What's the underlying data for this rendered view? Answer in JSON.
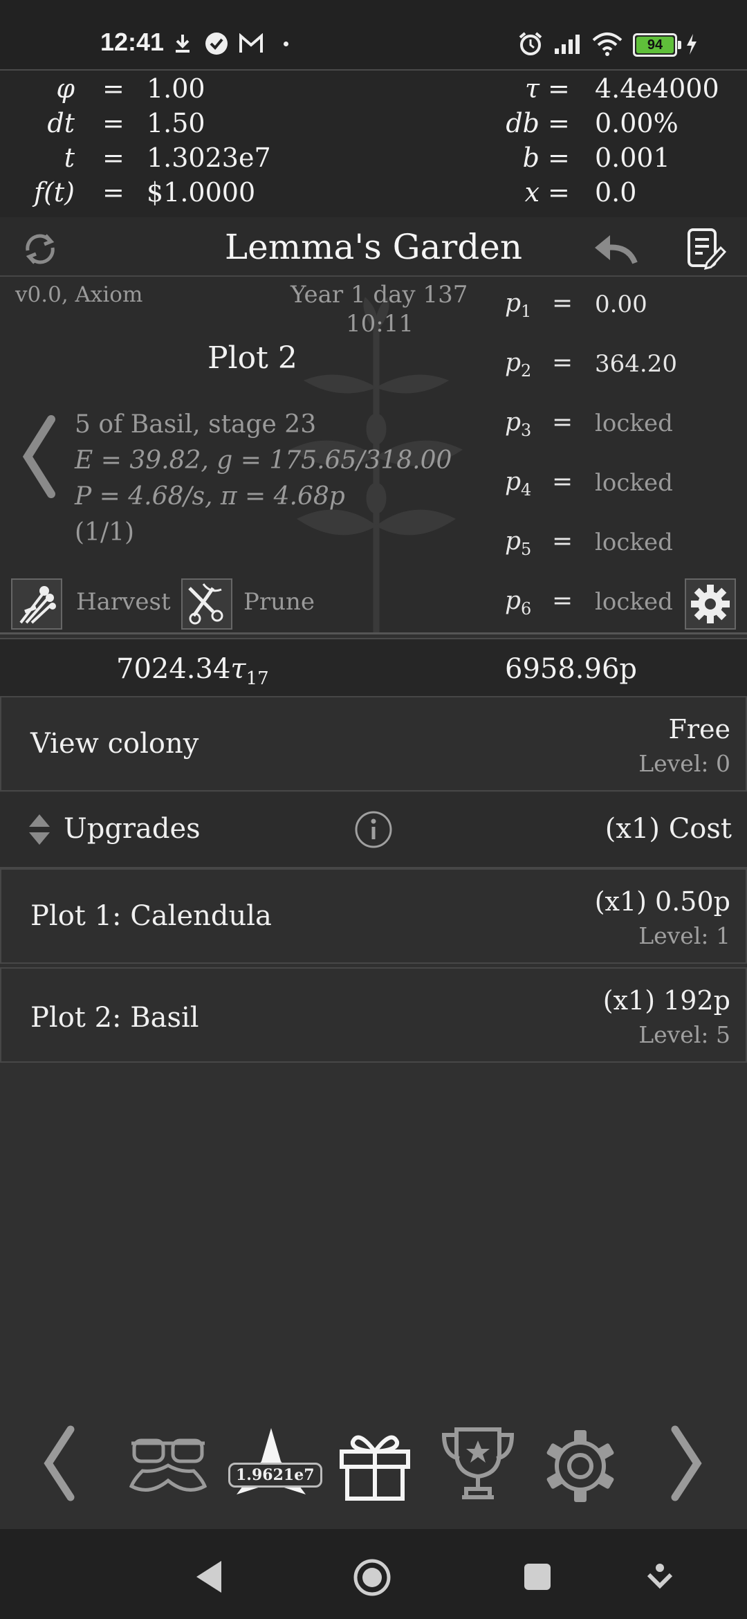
{
  "status_bar": {
    "time": "12:41",
    "battery_level": "94",
    "icons": [
      "download-icon",
      "check-circle-icon",
      "gmail-icon",
      "dot-icon",
      "alarm-icon",
      "signal-icon",
      "wifi-icon",
      "battery-icon",
      "charging-icon"
    ]
  },
  "equations": {
    "left": [
      {
        "lhs": "φ",
        "op": "=",
        "rhs": "1.00"
      },
      {
        "lhs": "dt",
        "op": "=",
        "rhs": "1.50"
      },
      {
        "lhs": "t",
        "op": "=",
        "rhs": "1.3023e7"
      },
      {
        "lhs": "f(t)",
        "op": "=",
        "rhs": "$1.0000"
      }
    ],
    "right": [
      {
        "lhs": "τ",
        "op": "=",
        "rhs": "4.4e4000"
      },
      {
        "lhs": "db",
        "op": "=",
        "rhs": "0.00%"
      },
      {
        "lhs": "b",
        "op": "=",
        "rhs": "0.001"
      },
      {
        "lhs": "x",
        "op": "=",
        "rhs": "0.0"
      }
    ]
  },
  "header": {
    "title": "Lemma's Garden",
    "icons": [
      "refresh-icon",
      "undo-icon",
      "notes-edit-icon"
    ]
  },
  "garden": {
    "version": "v0.0, Axiom",
    "date": "Year 1 day 137",
    "clock": "10:11",
    "plot_title": "Plot 2",
    "plant_lines": [
      "5 of Basil,  stage 23",
      "E = 39.82,  g = 175.65/318.00",
      "P = 4.68/s,  π = 4.68p",
      "(1/1)"
    ],
    "harvest_label": "Harvest",
    "prune_label": "Prune",
    "params": [
      {
        "name": "p",
        "sub": "1",
        "op": "=",
        "value": "0.00"
      },
      {
        "name": "p",
        "sub": "2",
        "op": "=",
        "value": "364.20"
      },
      {
        "name": "p",
        "sub": "3",
        "op": "=",
        "value": "locked"
      },
      {
        "name": "p",
        "sub": "4",
        "op": "=",
        "value": "locked"
      },
      {
        "name": "p",
        "sub": "5",
        "op": "=",
        "value": "locked"
      },
      {
        "name": "p",
        "sub": "6",
        "op": "=",
        "value": "locked"
      }
    ]
  },
  "totals": {
    "tau_value": "7024.34",
    "tau_symbol": "τ",
    "tau_sub": "17",
    "p_value": "6958.96p"
  },
  "colony": {
    "label": "View colony",
    "cost": "Free",
    "level": "Level: 0"
  },
  "upgrades": {
    "label": "Upgrades",
    "cost_header": "(x1) Cost",
    "items": [
      {
        "name": "Plot 1: Calendula",
        "cost": "(x1) 0.50p",
        "level": "Level: 1"
      },
      {
        "name": "Plot 2: Basil",
        "cost": "(x1) 192p",
        "level": "Level: 5"
      }
    ]
  },
  "tabs": {
    "star_badge": "1.9621e7",
    "icons": [
      "prev-arrow-icon",
      "disguise-glasses-icon",
      "star-icon",
      "gift-icon",
      "trophy-icon",
      "settings-gear-icon",
      "next-arrow-icon"
    ]
  },
  "colors": {
    "background": "#303030",
    "panel": "#262626",
    "text": "#f0f0f0",
    "dim_text": "#9a9a9a",
    "battery_green": "#5fbf3a"
  }
}
